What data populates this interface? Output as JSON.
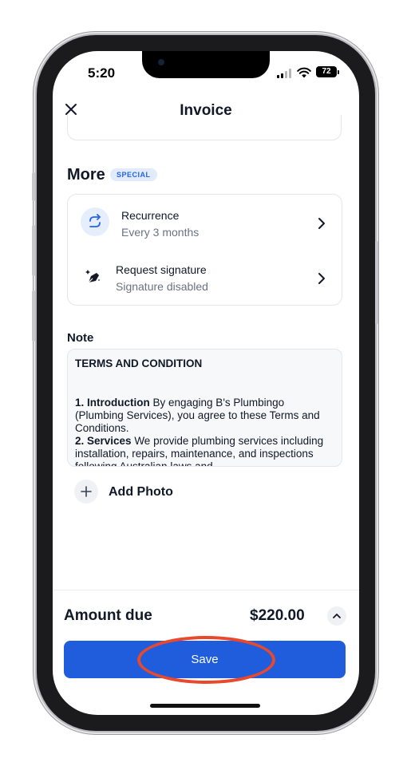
{
  "status_bar": {
    "time": "5:20",
    "battery": "72"
  },
  "header": {
    "title": "Invoice",
    "close_icon": "close-icon"
  },
  "more_section": {
    "title": "More",
    "badge": "SPECIAL",
    "items": [
      {
        "title": "Recurrence",
        "subtitle": "Every 3 months",
        "icon": "recurrence-icon"
      },
      {
        "title": "Request signature",
        "subtitle": "Signature disabled",
        "icon": "pen-sparkle-icon"
      }
    ]
  },
  "note": {
    "label": "Note",
    "heading": "TERMS AND CONDITION",
    "p1_bold": "1. Introduction",
    "p1_text": " By engaging B's Plumbingo (Plumbing Services), you agree to these Terms and Conditions.",
    "p2_bold": "2. Services",
    "p2_text": " We provide plumbing services including installation, repairs, maintenance, and inspections following Australian laws and"
  },
  "add_photo": {
    "label": "Add Photo"
  },
  "footer": {
    "amount_label": "Amount due",
    "amount_value": "$220.00",
    "save_label": "Save"
  },
  "colors": {
    "accent": "#1f5ddc",
    "highlight": "#e8492c",
    "badge_bg": "#e1ebfb"
  }
}
